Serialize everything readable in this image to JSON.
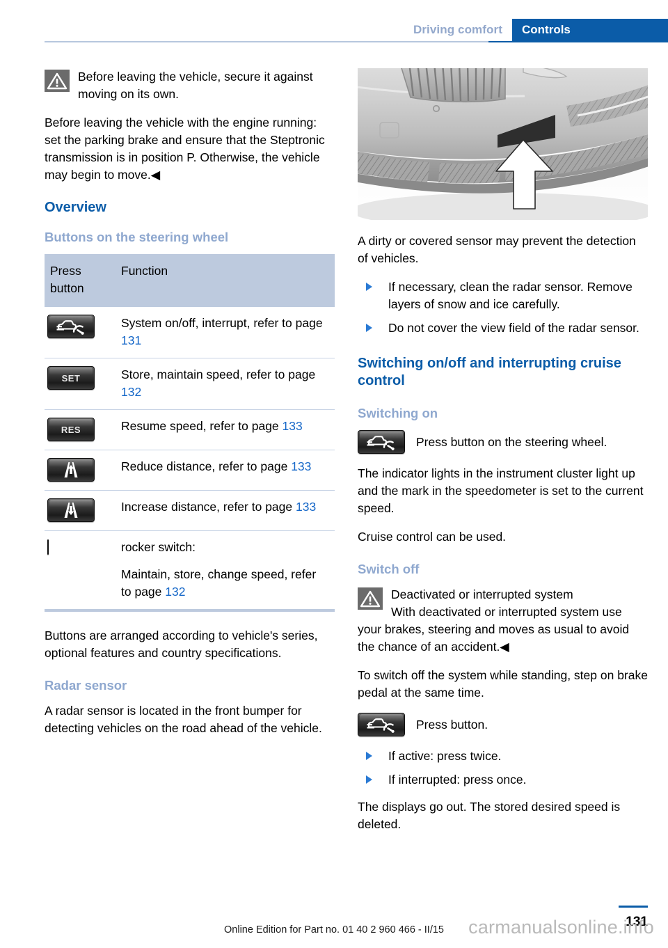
{
  "header": {
    "chapter": "Driving comfort",
    "section": "Controls"
  },
  "left_column": {
    "warning_top": {
      "icon": "warning-triangle-icon",
      "text": "Before leaving the vehicle, secure it against moving on its own."
    },
    "paragraph_1": "Before leaving the vehicle with the engine running: set the parking brake and ensure that the Steptronic transmission is in position P. Otherwise, the vehicle may begin to move.◀",
    "heading_overview": "Overview",
    "heading_buttons": "Buttons on the steering wheel",
    "table": {
      "columns": [
        "Press button",
        "Function"
      ],
      "rows": [
        {
          "icon": "cruise-control-button-icon",
          "icon_label": "",
          "text_before": "System on/off, interrupt, refer to page ",
          "page": "131"
        },
        {
          "icon": "set-button-icon",
          "icon_label": "SET",
          "text_before": "Store, maintain speed, refer to page ",
          "page": "132"
        },
        {
          "icon": "res-button-icon",
          "icon_label": "RES",
          "text_before": "Resume speed, refer to page ",
          "page": "133"
        },
        {
          "icon": "reduce-distance-button-icon",
          "icon_label": "",
          "text_before": "Reduce distance, refer to page ",
          "page": "133"
        },
        {
          "icon": "increase-distance-button-icon",
          "icon_label": "",
          "text_before": "Increase distance, refer to page ",
          "page": "133"
        },
        {
          "icon": "rocker-switch-icon",
          "icon_label": "",
          "text_line1": "rocker switch:",
          "text_before": "Maintain, store, change speed, refer to page ",
          "page": "132"
        }
      ]
    },
    "paragraph_2": "Buttons are arranged according to vehicle's series, optional features and country specifications.",
    "heading_radar": "Radar sensor",
    "paragraph_3": "A radar sensor is located in the front bumper for detecting vehicles on the road ahead of the vehicle."
  },
  "right_column": {
    "figure_alt": "front-bumper-radar-sensor-photo",
    "paragraph_1": "A dirty or covered sensor may prevent the detection of vehicles.",
    "bullets_1": [
      "If necessary, clean the radar sensor. Remove layers of snow and ice carefully.",
      "Do not cover the view field of the radar sensor."
    ],
    "heading_switching": "Switching on/off and interrupting cruise control",
    "heading_switch_on": "Switching on",
    "press_button_steering": "Press button on the steering wheel.",
    "paragraph_2": "The indicator lights in the instrument cluster light up and the mark in the speedometer is set to the current speed.",
    "paragraph_3": "Cruise control can be used.",
    "heading_switch_off": "Switch off",
    "warning_title": "Deactivated or interrupted system",
    "warning_body": "With deactivated or interrupted system use your brakes, steering and moves as usual to avoid the chance of an accident.◀",
    "paragraph_4": "To switch off the system while standing, step on brake pedal at the same time.",
    "press_button": "Press button.",
    "bullets_2": [
      "If active: press twice.",
      "If interrupted: press once."
    ],
    "paragraph_5": "The displays go out. The stored desired speed is deleted."
  },
  "footer": {
    "edition": "Online Edition for Part no. 01 40 2 960 466 - II/15",
    "page_number": "131",
    "watermark": "carmanualsonline.info"
  },
  "colors": {
    "accent_blue": "#0b5ca8",
    "light_blue_heading": "#8fa8cf",
    "table_header_bg": "#bdcade",
    "page_ref": "#1567c8"
  }
}
